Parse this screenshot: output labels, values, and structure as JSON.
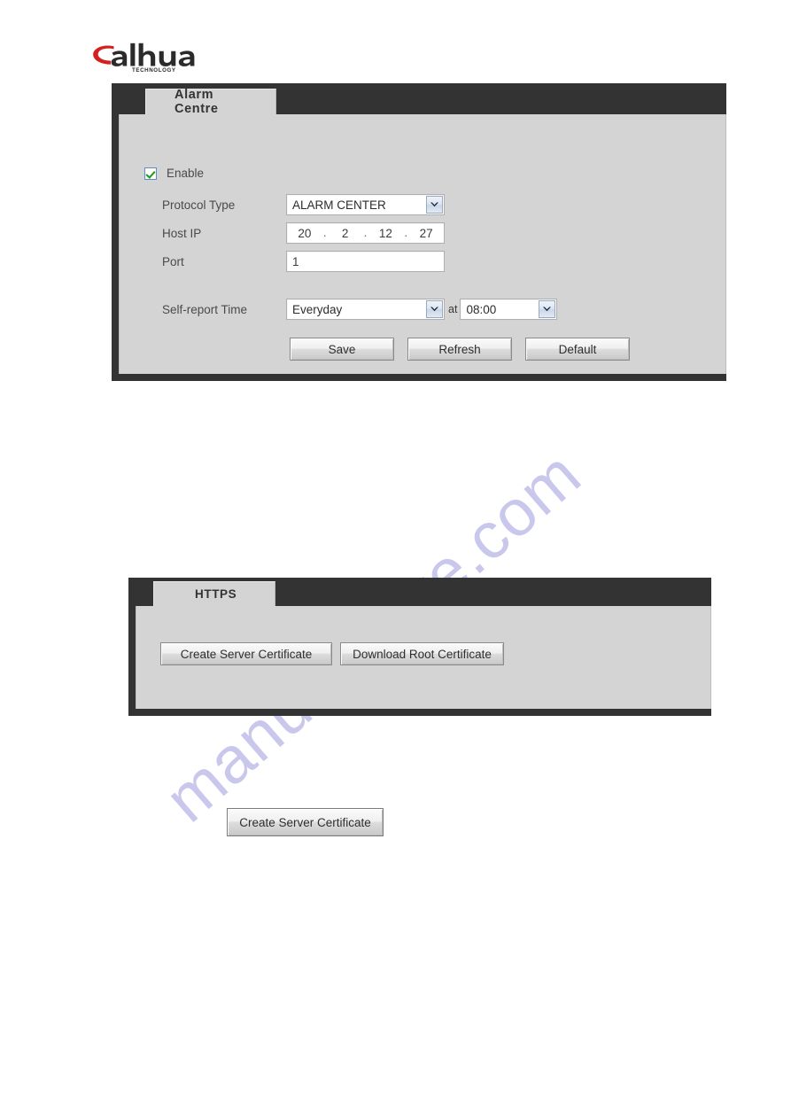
{
  "logo": {
    "brand": "alhua",
    "brand_prefix": "a",
    "brand_rest": "hua",
    "tagline": "TECHNOLOGY",
    "accent_color": "#d4201e",
    "text_color": "#2b2b2b"
  },
  "watermark": {
    "text": "manualshive.com",
    "color": "#c9c8ec"
  },
  "alarm_centre": {
    "tab_label": "Alarm Centre",
    "enable": {
      "label": "Enable",
      "checked": true
    },
    "protocol_type": {
      "label": "Protocol Type",
      "value": "ALARM CENTER"
    },
    "host_ip": {
      "label": "Host IP",
      "octets": [
        "20",
        "2",
        "12",
        "27"
      ],
      "separator": "."
    },
    "port": {
      "label": "Port",
      "value": "1"
    },
    "self_report": {
      "label": "Self-report Time",
      "day_value": "Everyday",
      "at_label": "at",
      "time_value": "08:00"
    },
    "buttons": {
      "save": "Save",
      "refresh": "Refresh",
      "default": "Default"
    }
  },
  "https_panel": {
    "tab_label": "HTTPS",
    "buttons": {
      "create_server_certificate": "Create Server Certificate",
      "download_root_certificate": "Download Root Certificate"
    }
  },
  "standalone_button": {
    "label": "Create Server Certificate"
  }
}
